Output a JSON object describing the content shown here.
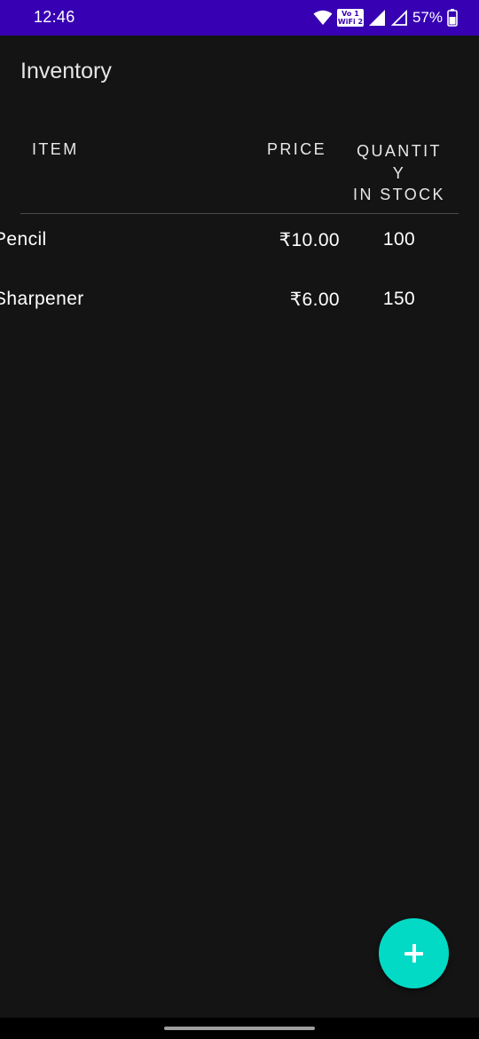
{
  "status_bar": {
    "time": "12:46",
    "vowifi_label": "Vo 1\nWiFi 2",
    "battery_percent": "57%",
    "color": "#3700b3",
    "icons": [
      "wifi-icon",
      "vowifi-icon",
      "signal-icon",
      "signal-icon",
      "battery-icon"
    ]
  },
  "app": {
    "title": "Inventory"
  },
  "table": {
    "headers": {
      "item": "ITEM",
      "price": "PRICE",
      "quantity_line1": "QUANTIT",
      "quantity_line2": "Y",
      "quantity_line3": "IN STOCK"
    },
    "rows": [
      {
        "name": "Pencil",
        "price": "₹10.00",
        "quantity": "100"
      },
      {
        "name": "Sharpener",
        "price": "₹6.00",
        "quantity": "150"
      }
    ]
  },
  "fab": {
    "icon": "plus-icon",
    "color": "#03dac5"
  },
  "colors": {
    "background": "#141414",
    "accent": "#03dac5",
    "primary_dark": "#3700b3"
  }
}
